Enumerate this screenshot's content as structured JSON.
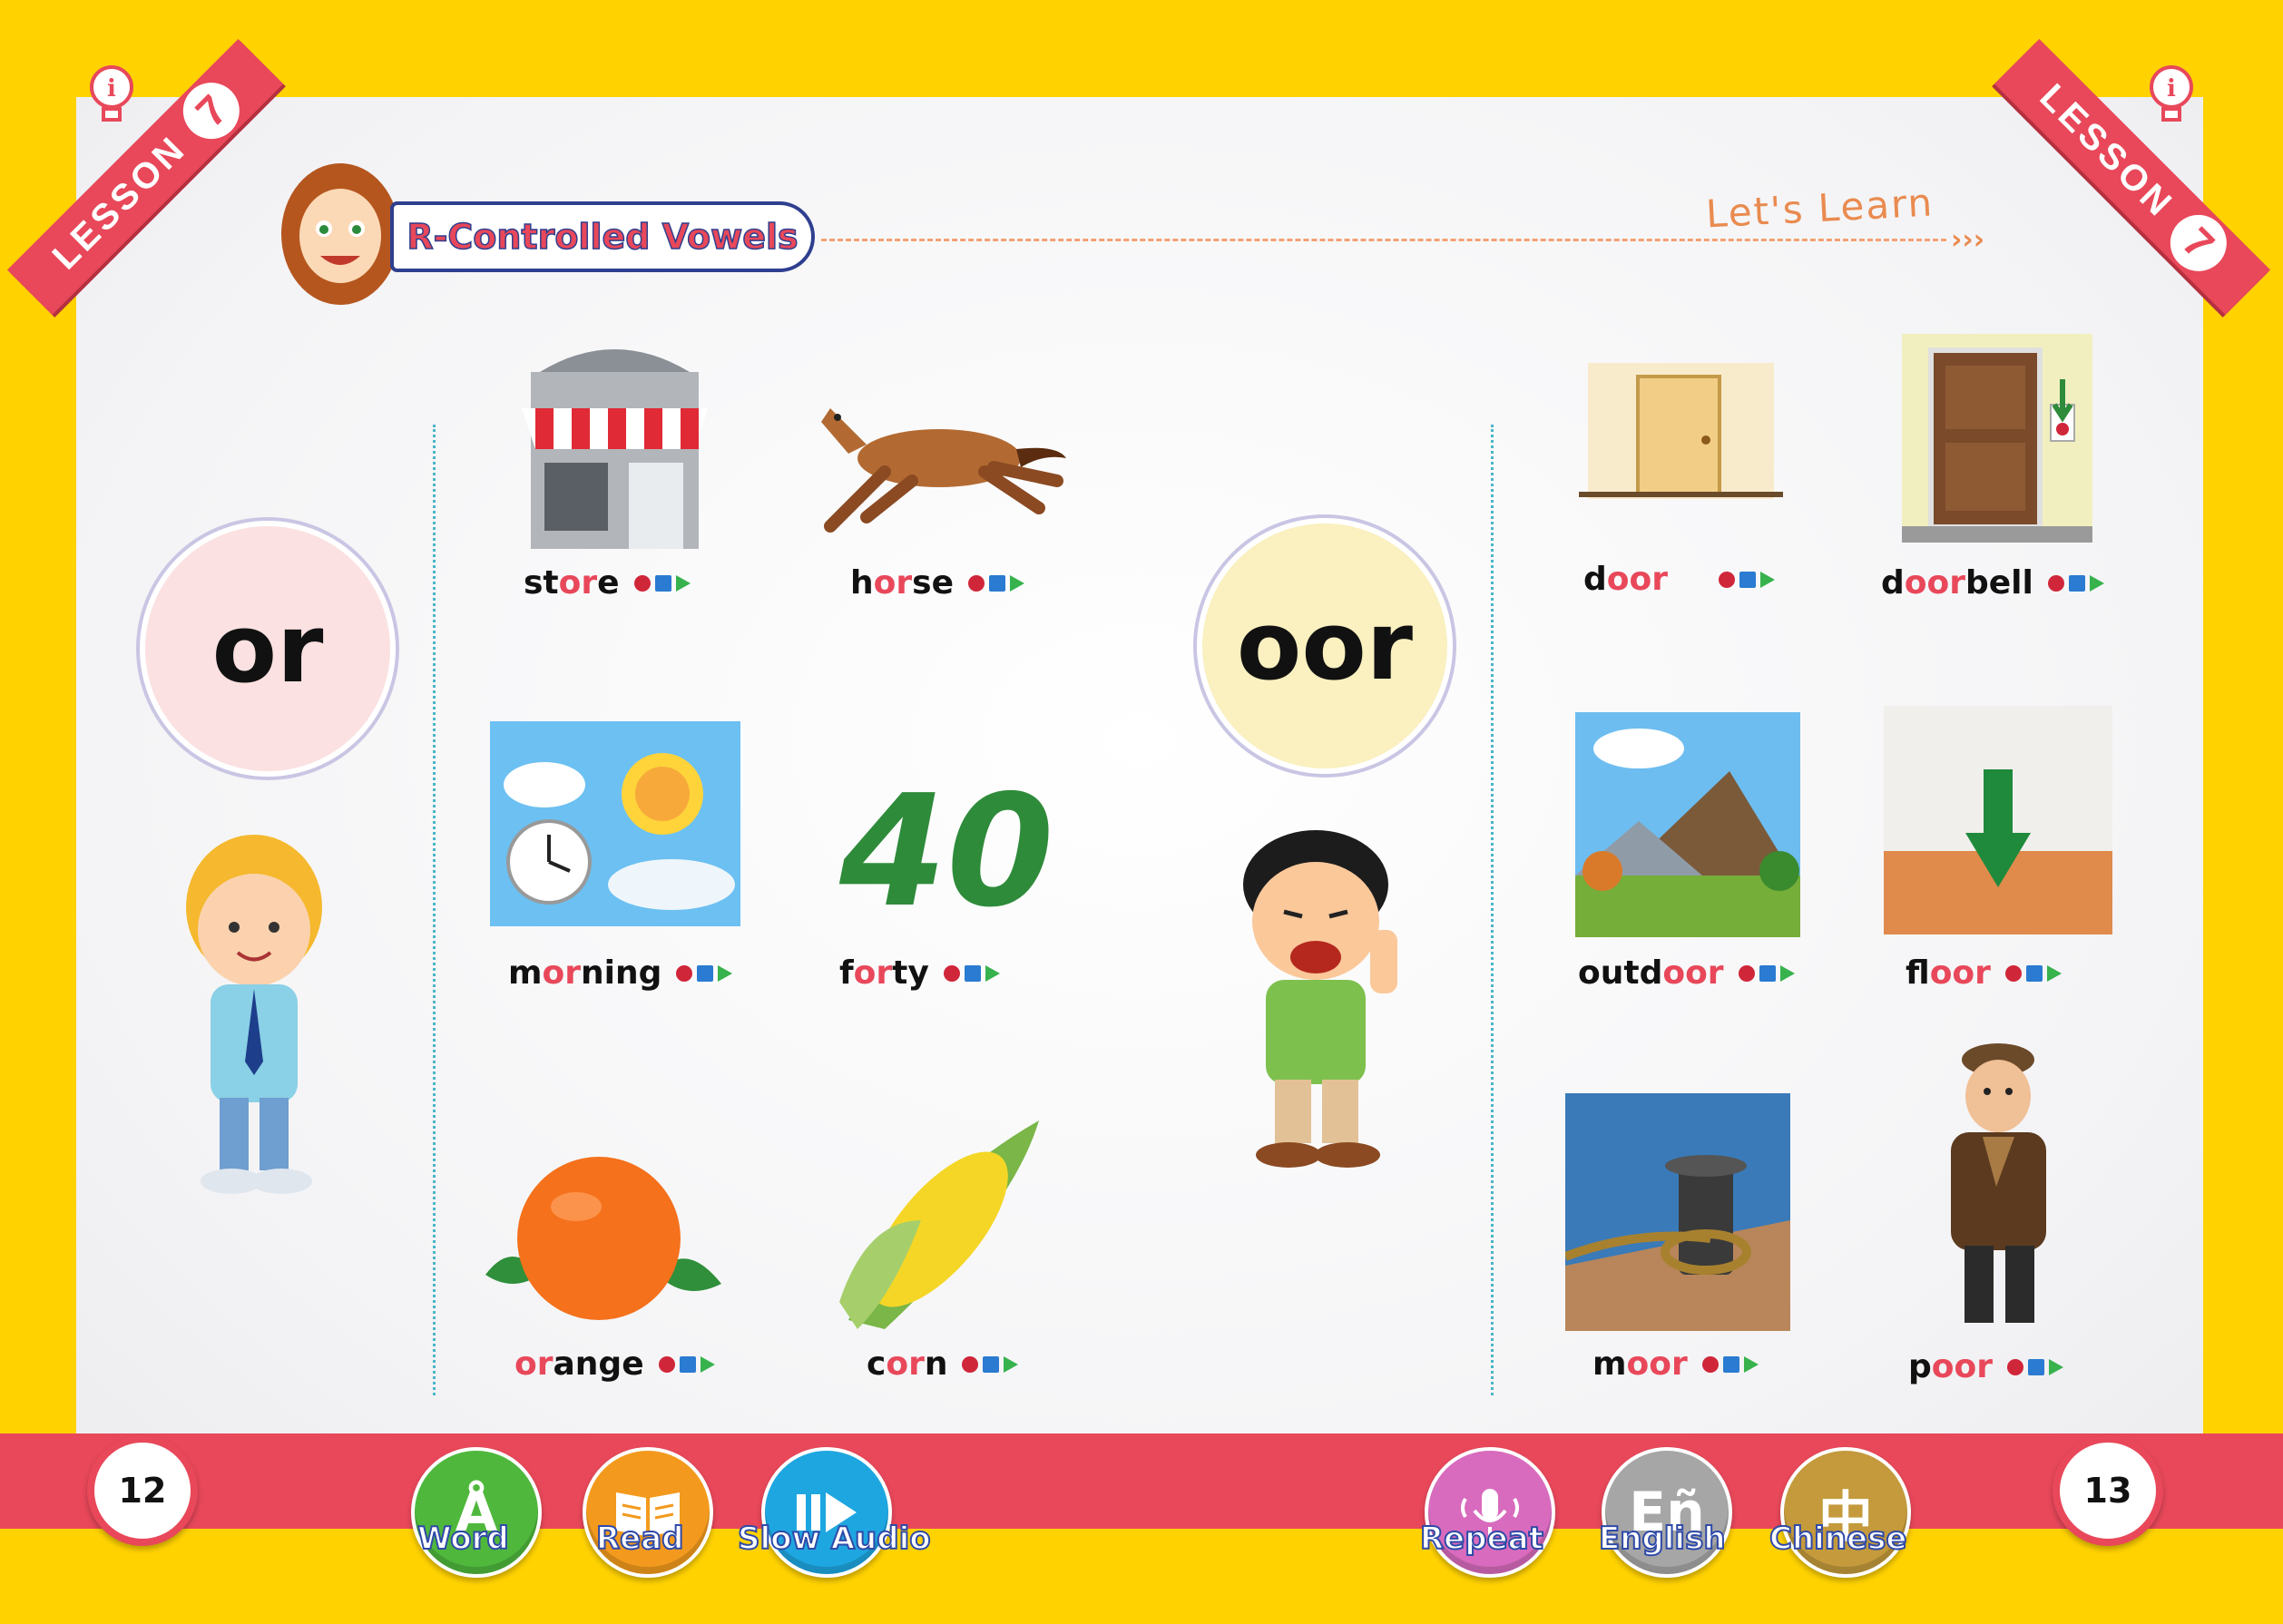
{
  "header": {
    "lesson_label": "LESSON",
    "lesson_number": "7",
    "title": "R-Controlled Vowels",
    "section": "Let's Learn"
  },
  "left_page": {
    "pattern": "or",
    "words": [
      {
        "pre": "st",
        "hl": "or",
        "post": "e"
      },
      {
        "pre": "h",
        "hl": "or",
        "post": "se"
      },
      {
        "pre": "m",
        "hl": "or",
        "post": "ning"
      },
      {
        "pre": "f",
        "hl": "or",
        "post": "ty"
      },
      {
        "pre": "",
        "hl": "or",
        "post": "ange"
      },
      {
        "pre": "c",
        "hl": "or",
        "post": "n"
      }
    ],
    "number_picture": "40",
    "page_number": "12"
  },
  "right_page": {
    "pattern": "oor",
    "words": [
      {
        "pre": "d",
        "hl": "oor",
        "post": ""
      },
      {
        "pre": "d",
        "hl": "oor",
        "post": "bell"
      },
      {
        "pre": "outd",
        "hl": "oor",
        "post": ""
      },
      {
        "pre": "fl",
        "hl": "oor",
        "post": ""
      },
      {
        "pre": "m",
        "hl": "oor",
        "post": ""
      },
      {
        "pre": "p",
        "hl": "oor",
        "post": ""
      }
    ],
    "page_number": "13"
  },
  "toolbar": {
    "word": "Word",
    "read": "Read",
    "slow_audio": "Slow Audio",
    "repeat": "Repeat",
    "english": "English",
    "chinese": "Chinese"
  },
  "icons": {
    "word": "letter-a-icon",
    "read": "book-icon",
    "slow_audio": "slow-play-icon",
    "repeat": "microphone-icon",
    "english": "en-icon",
    "chinese": "zhong-icon"
  },
  "colors": {
    "frame": "#ffd200",
    "accent": "#e8485a",
    "or_circle": "#fbe1e1",
    "oor_circle": "#faf0c0",
    "word_btn": "#4fb83c",
    "read_btn": "#f39a1e",
    "slow_btn": "#1ea6e0",
    "repeat_btn": "#d86bbd",
    "english_btn": "#a6a6a6",
    "chinese_btn": "#c49a3c"
  }
}
